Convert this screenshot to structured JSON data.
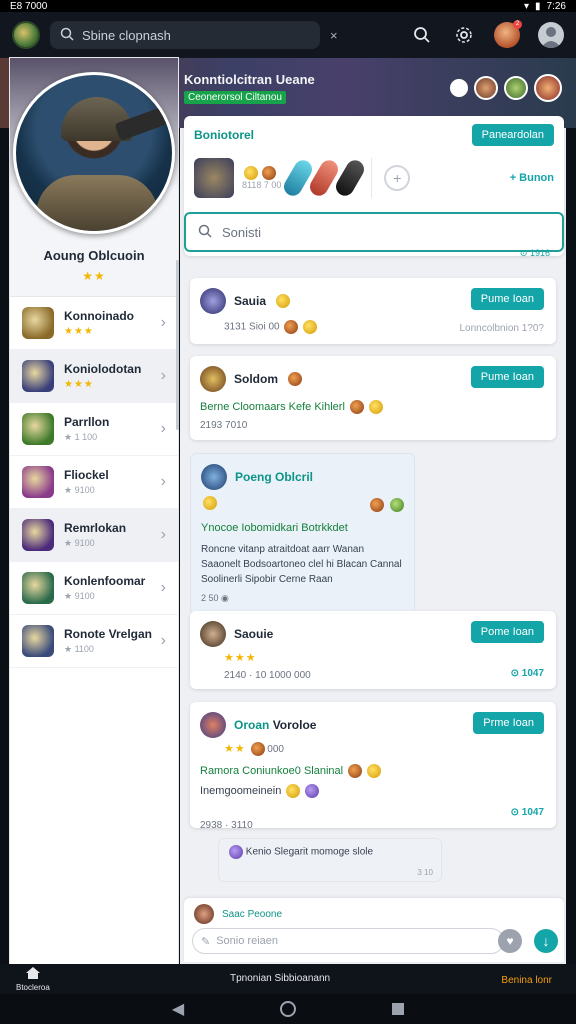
{
  "status_bar": {
    "left": "E8 7000",
    "time": "7:26"
  },
  "top_bar": {
    "search_text": "Sbine clopnash",
    "close_glyph": "×",
    "search_icon": "search-icon",
    "settings_icon": "gear-icon",
    "badge": "2"
  },
  "profile": {
    "name": "Aoung Oblcuoin",
    "stars": "★★"
  },
  "games": [
    {
      "title": "Konnoinado",
      "sub": "★★★",
      "stars": true,
      "color": "#8a6a2a"
    },
    {
      "title": "Koniolodotan",
      "sub": "★★★",
      "stars": true,
      "color": "#3a3f7a"
    },
    {
      "title": "Parrllon",
      "sub": "★ 1 100",
      "stars": false,
      "color": "#3d7a2a"
    },
    {
      "title": "Fliockel",
      "sub": "★ 9100",
      "stars": false,
      "color": "#8a3a8a"
    },
    {
      "title": "Remrlokan",
      "sub": "★ 9100",
      "stars": false,
      "color": "#4a2a7a"
    },
    {
      "title": "Konlenfoomar",
      "sub": "★ 9100",
      "stars": false,
      "color": "#2a6a4a"
    },
    {
      "title": "Ronote Vrelgan",
      "sub": "★ 1100",
      "stars": false,
      "color": "#3a4a7a"
    }
  ],
  "header": {
    "title": "Konntiolcitran Ueane",
    "tag": "Ceonerorsol Ciltanou"
  },
  "top_card": {
    "title": "Boniotorel",
    "button": "Paneardolan",
    "meta": "8118 7 00",
    "link": "+ Bunon"
  },
  "search": {
    "placeholder": "Sonisti",
    "sub_hint": "⊙ 1916"
  },
  "cards": [
    {
      "name": "Sauia",
      "meta": "3131 Sioi 00",
      "button": "Pume Ioan",
      "time": "Lonncolbnion 1?0?"
    },
    {
      "name": "Soldom",
      "greenline": "Berne Cloomaars Kefe Kihlerl",
      "meta": "2193 7010",
      "button": "Pume Ioan"
    },
    {
      "name": "Saouie",
      "stars": "★★★",
      "meta": "2140 · 10 1000 000",
      "button": "Pome Ioan",
      "time": "⊙ 1047"
    },
    {
      "name_hl": "Oroan",
      "name": "Voroloe",
      "stars": "★★",
      "starnum": "000",
      "greenline": "Ramora Coniunkoe0 Slaninal",
      "extra": "Inemgoomeinein",
      "meta": "2938 · 3110",
      "button": "Prme Ioan",
      "time": "⊙ 1047"
    }
  ],
  "bubble": {
    "name": "Poeng Oblcril",
    "greenline": "Ynocoe Iobomidkari Botrkkdet",
    "message": "Roncne vitanp atraitdoat aarr Wanan Saaonelt Bodsoartoneo clel hi Blacan Cannal Soolinerli Sipobir Cerne Raan",
    "sub": "2 50 ◉"
  },
  "reply": {
    "text": "Kenio Slegarit momoge slole",
    "time": "3 10"
  },
  "composer": {
    "who": "Saac Peoone",
    "placeholder": "Sonio reiaen"
  },
  "bottom_nav": {
    "home": "Btocleroa",
    "center": "Tpnonian Sibbioanann",
    "right": "Benina lonr"
  }
}
